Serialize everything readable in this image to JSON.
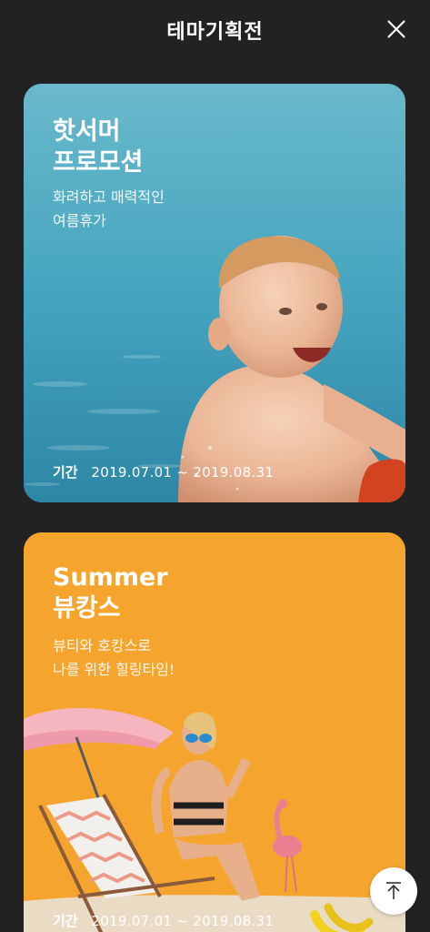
{
  "header": {
    "title": "테마기획전",
    "close_icon": "close-icon"
  },
  "cards": [
    {
      "title_lines": [
        "핫서머",
        "프로모션"
      ],
      "desc_lines": [
        "화려하고 매력적인",
        "여름휴가"
      ],
      "period_label": "기간",
      "period_value": "2019.07.01 ~ 2019.08.31",
      "image": "baby-swimming-pool-photo"
    },
    {
      "title_lines": [
        "Summer",
        "뷰캉스"
      ],
      "desc_lines": [
        "뷰티와 호캉스로",
        "나를 위한 힐링타임!"
      ],
      "period_label": "기간",
      "period_value": "2019.07.01 ~ 2019.08.31",
      "image": "woman-beach-umbrella-flamingo-photo"
    }
  ],
  "scroll_top": {
    "icon": "arrow-up-icon"
  },
  "colors": {
    "background": "#222222",
    "card1": "#3c98b3",
    "card2": "#f5a52e"
  }
}
